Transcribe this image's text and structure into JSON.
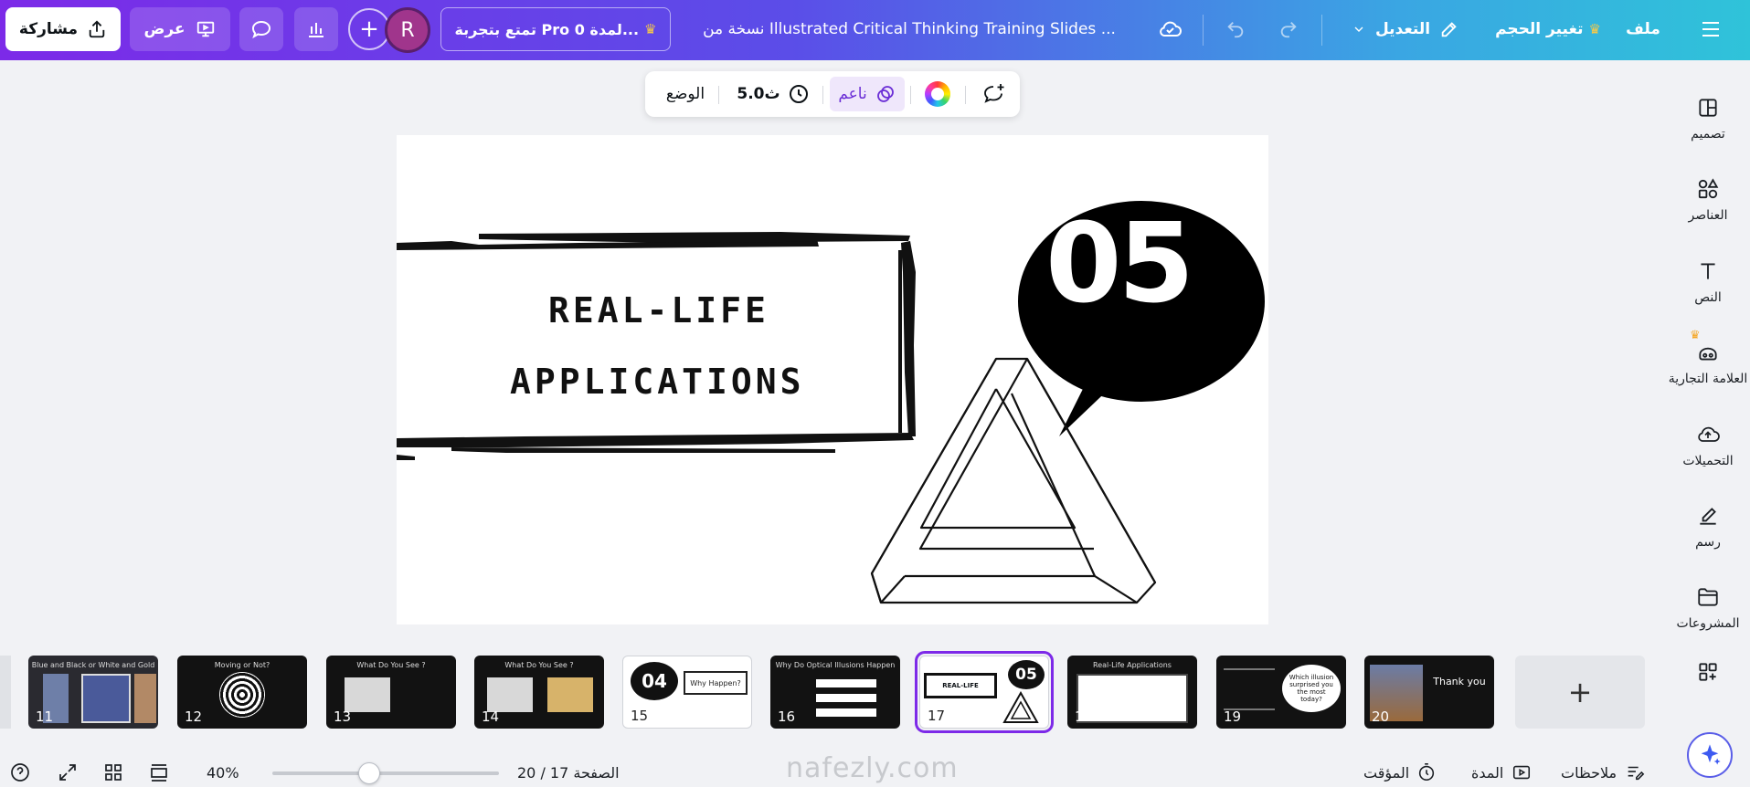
{
  "topbar": {
    "share_label": "مشاركة",
    "present_label": "عرض",
    "avatar_initial": "R",
    "pro_trial_label": "تمتع بتجربة Pro لمدة 0...",
    "doc_title": "نسخة من Illustrated Critical Thinking Training Slides ...",
    "edit_label": "التعديل",
    "resize_label": "تغيير الحجم",
    "file_label": "ملف",
    "brand_gradient": [
      "#7c2ae8",
      "#3aa6e3",
      "#2fc3d9"
    ]
  },
  "floatbar": {
    "mode_label": "الوضع",
    "duration_label": "5.0ث",
    "smooth_label": "ناعم"
  },
  "slide": {
    "title_line1": "REAL-LIFE",
    "title_line2": "APPLICATIONS",
    "number": "05"
  },
  "sidebar": {
    "items": [
      {
        "label": "تصميم",
        "icon": "design-icon"
      },
      {
        "label": "العناصر",
        "icon": "elements-icon"
      },
      {
        "label": "النص",
        "icon": "text-icon"
      },
      {
        "label": "العلامة التجارية",
        "icon": "brand-icon"
      },
      {
        "label": "التحميلات",
        "icon": "upload-icon"
      },
      {
        "label": "رسم",
        "icon": "draw-icon"
      },
      {
        "label": "المشروعات",
        "icon": "folder-icon"
      }
    ]
  },
  "thumbnails": [
    {
      "num": "11",
      "title": "Blue and Black or White and Gold"
    },
    {
      "num": "12",
      "title": "Moving or Not?"
    },
    {
      "num": "13",
      "title": "What Do You See ?"
    },
    {
      "num": "14",
      "title": "What Do You See ?"
    },
    {
      "num": "15",
      "title": "Why Happen?"
    },
    {
      "num": "16",
      "title": "Why Do Optical Illusions Happen"
    },
    {
      "num": "17",
      "title": ""
    },
    {
      "num": "18",
      "title": "Real-Life Applications"
    },
    {
      "num": "19",
      "title": "Which illusion surprised you the most today?"
    },
    {
      "num": "20",
      "title": "Thank you"
    }
  ],
  "statusbar": {
    "notes_label": "ملاحظات",
    "duration_label": "المدة",
    "timer_label": "المؤقت",
    "page_indicator": "الصفحة 17 / 20",
    "zoom": "40%",
    "zoom_fraction": 0.4
  },
  "watermark": "nafezly.com"
}
